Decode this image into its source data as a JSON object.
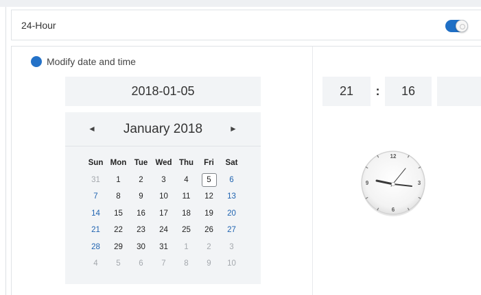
{
  "settings": {
    "hour24_label": "24-Hour",
    "hour24_enabled": true,
    "modify_label": "Modify date and time"
  },
  "date": {
    "value": "2018-01-05"
  },
  "calendar": {
    "title": "January 2018",
    "prev_icon": "◄",
    "next_icon": "►",
    "weekdays": [
      "Sun",
      "Mon",
      "Tue",
      "Wed",
      "Thu",
      "Fri",
      "Sat"
    ],
    "weeks": [
      [
        "31",
        "1",
        "2",
        "3",
        "4",
        "5",
        "6"
      ],
      [
        "7",
        "8",
        "9",
        "10",
        "11",
        "12",
        "13"
      ],
      [
        "14",
        "15",
        "16",
        "17",
        "18",
        "19",
        "20"
      ],
      [
        "21",
        "22",
        "23",
        "24",
        "25",
        "26",
        "27"
      ],
      [
        "28",
        "29",
        "30",
        "31",
        "1",
        "2",
        "3"
      ],
      [
        "4",
        "5",
        "6",
        "7",
        "8",
        "9",
        "10"
      ]
    ],
    "selected_day": "5"
  },
  "time": {
    "hour": "21",
    "separator": ":",
    "minute": "16",
    "second": ""
  },
  "clock": {
    "numbers": [
      "12",
      "3",
      "6",
      "9"
    ]
  },
  "colors": {
    "accent": "#1f6fc5",
    "weekend": "#1f63b0",
    "box_bg": "#f2f4f6"
  }
}
